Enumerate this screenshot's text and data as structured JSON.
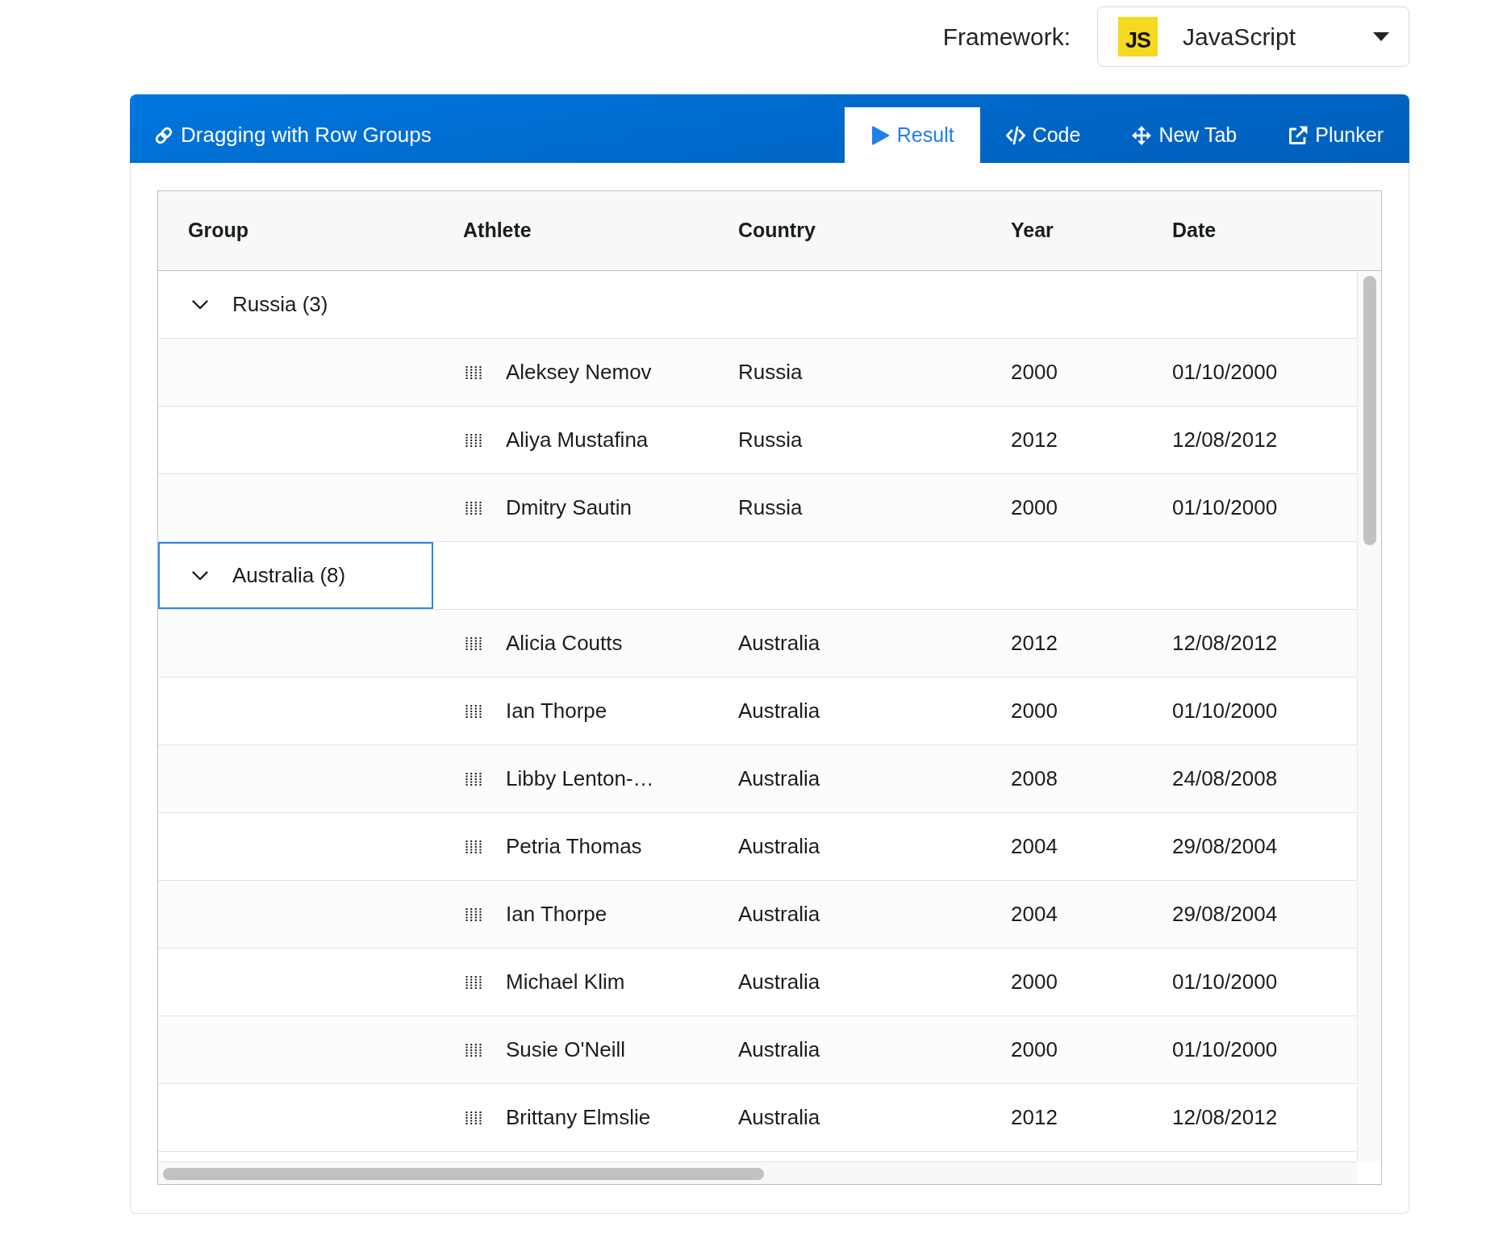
{
  "framework_selector": {
    "label": "Framework:",
    "logo": "JS",
    "value": "JavaScript"
  },
  "example_header": {
    "title": "Dragging with Row Groups",
    "tabs": [
      {
        "label": "Result",
        "kind": "play",
        "selected": true
      },
      {
        "label": "Code",
        "kind": "code",
        "selected": false
      },
      {
        "label": "New Tab",
        "kind": "move",
        "selected": false
      },
      {
        "label": "Plunker",
        "kind": "external",
        "selected": false
      }
    ]
  },
  "grid": {
    "columns": [
      "Group",
      "Athlete",
      "Country",
      "Year",
      "Date"
    ],
    "rows": [
      {
        "kind": "group",
        "label": "Russia (3)",
        "expanded": true,
        "focused": false
      },
      {
        "kind": "athlete",
        "athlete": "Aleksey Nemov",
        "country": "Russia",
        "year": "2000",
        "date": "01/10/2000"
      },
      {
        "kind": "athlete",
        "athlete": "Aliya Mustafina",
        "country": "Russia",
        "year": "2012",
        "date": "12/08/2012"
      },
      {
        "kind": "athlete",
        "athlete": "Dmitry Sautin",
        "country": "Russia",
        "year": "2000",
        "date": "01/10/2000"
      },
      {
        "kind": "group",
        "label": "Australia (8)",
        "expanded": true,
        "focused": true
      },
      {
        "kind": "athlete",
        "athlete": "Alicia Coutts",
        "country": "Australia",
        "year": "2012",
        "date": "12/08/2012"
      },
      {
        "kind": "athlete",
        "athlete": "Ian Thorpe",
        "country": "Australia",
        "year": "2000",
        "date": "01/10/2000"
      },
      {
        "kind": "athlete",
        "athlete": "Libby Lenton-…",
        "country": "Australia",
        "year": "2008",
        "date": "24/08/2008"
      },
      {
        "kind": "athlete",
        "athlete": "Petria Thomas",
        "country": "Australia",
        "year": "2004",
        "date": "29/08/2004"
      },
      {
        "kind": "athlete",
        "athlete": "Ian Thorpe",
        "country": "Australia",
        "year": "2004",
        "date": "29/08/2004"
      },
      {
        "kind": "athlete",
        "athlete": "Michael Klim",
        "country": "Australia",
        "year": "2000",
        "date": "01/10/2000"
      },
      {
        "kind": "athlete",
        "athlete": "Susie O'Neill",
        "country": "Australia",
        "year": "2000",
        "date": "01/10/2000"
      },
      {
        "kind": "athlete",
        "athlete": "Brittany Elmslie",
        "country": "Australia",
        "year": "2012",
        "date": "12/08/2012"
      }
    ]
  }
}
